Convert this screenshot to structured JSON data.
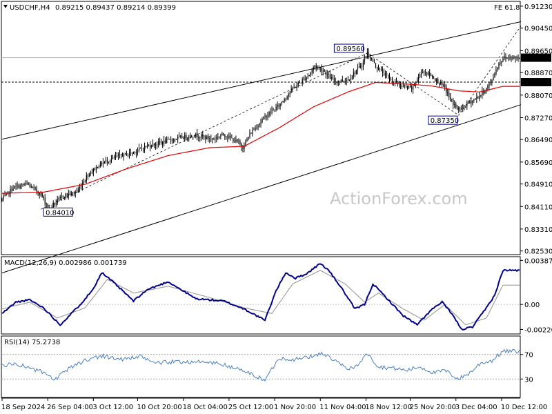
{
  "header": {
    "symbol_label": "USDCHF,H4",
    "ohlc_text": "0.89215 0.89437 0.89214 0.89399",
    "fe_label": "FE 61.8"
  },
  "watermark": "ActionForex.com",
  "colors": {
    "candle": "#000000",
    "ma": "#e00000",
    "macd_main": "#00008b",
    "macd_signal": "#909090",
    "channel": "#000000",
    "fib_dash": "#000000",
    "level_box": "#00008b",
    "price_tag_bg": "#000000",
    "price_tag_text": "#ffffff",
    "rsi_line": "#4a7fbf"
  },
  "chart_data": [
    {
      "type": "line",
      "panel": "price",
      "title": "USDCHF,H4",
      "ylim": [
        0.824,
        0.914
      ],
      "yticks": [
        "0.91230",
        "0.90450",
        "0.89650",
        "0.88870",
        "0.88070",
        "0.87270",
        "0.86490",
        "0.85690",
        "0.84910",
        "0.84110",
        "0.83310",
        "0.82530"
      ],
      "x_labels": [
        "18 Sep 2024",
        "26 Sep 04:00",
        "3 Oct 12:00",
        "10 Oct 20:00",
        "18 Oct 04:00",
        "25 Oct 12:00",
        "1 Nov 20:00",
        "11 Nov 04:00",
        "18 Nov 12:00",
        "25 Nov 20:00",
        "3 Dec 04:00",
        "10 Dec 12:00"
      ],
      "price_path": [
        [
          0,
          0.8436
        ],
        [
          8,
          0.8478
        ],
        [
          18,
          0.8491
        ],
        [
          28,
          0.8455
        ],
        [
          34,
          0.8402
        ],
        [
          44,
          0.8449
        ],
        [
          54,
          0.8462
        ],
        [
          62,
          0.8525
        ],
        [
          72,
          0.8565
        ],
        [
          84,
          0.859
        ],
        [
          94,
          0.8602
        ],
        [
          104,
          0.8625
        ],
        [
          116,
          0.864
        ],
        [
          128,
          0.8655
        ],
        [
          140,
          0.8665
        ],
        [
          152,
          0.865
        ],
        [
          160,
          0.8668
        ],
        [
          170,
          0.864
        ],
        [
          174,
          0.8622
        ],
        [
          180,
          0.8675
        ],
        [
          190,
          0.873
        ],
        [
          200,
          0.877
        ],
        [
          210,
          0.883
        ],
        [
          222,
          0.888
        ],
        [
          226,
          0.8912
        ],
        [
          232,
          0.8895
        ],
        [
          240,
          0.8855
        ],
        [
          250,
          0.8862
        ],
        [
          260,
          0.8915
        ],
        [
          264,
          0.8956
        ],
        [
          270,
          0.891
        ],
        [
          280,
          0.8865
        ],
        [
          288,
          0.884
        ],
        [
          296,
          0.883
        ],
        [
          304,
          0.8895
        ],
        [
          312,
          0.8868
        ],
        [
          320,
          0.8832
        ],
        [
          324,
          0.879
        ],
        [
          330,
          0.8753
        ],
        [
          336,
          0.8775
        ],
        [
          344,
          0.88
        ],
        [
          350,
          0.883
        ],
        [
          354,
          0.886
        ],
        [
          358,
          0.891
        ],
        [
          362,
          0.894
        ]
      ],
      "ma_path": [
        [
          0,
          0.8458
        ],
        [
          30,
          0.8462
        ],
        [
          60,
          0.849
        ],
        [
          90,
          0.8545
        ],
        [
          120,
          0.8592
        ],
        [
          150,
          0.862
        ],
        [
          175,
          0.8625
        ],
        [
          200,
          0.869
        ],
        [
          225,
          0.8765
        ],
        [
          250,
          0.8818
        ],
        [
          270,
          0.8852
        ],
        [
          290,
          0.8847
        ],
        [
          310,
          0.884
        ],
        [
          330,
          0.8822
        ],
        [
          345,
          0.8818
        ],
        [
          362,
          0.8838
        ]
      ],
      "channel_upper": [
        [
          0,
          0.865
        ],
        [
          375,
          0.9068
        ]
      ],
      "channel_lower": [
        [
          0,
          0.8175
        ],
        [
          375,
          0.8773
        ]
      ],
      "fib_path": [
        [
          28,
          0.8401
        ],
        [
          264,
          0.8956
        ],
        [
          330,
          0.8735
        ],
        [
          375,
          0.9053
        ]
      ],
      "hlines": [
        {
          "value": 0.89399,
          "style": "solid",
          "label": "0.89399"
        },
        {
          "value": 0.8853,
          "style": "dashed",
          "label": "0.88530"
        }
      ],
      "annotations": [
        {
          "label": "0.84010",
          "x": 28,
          "value": 0.8401
        },
        {
          "label": "0.89560",
          "x": 264,
          "value": 0.8956
        },
        {
          "label": "0.87350",
          "x": 330,
          "value": 0.8735
        }
      ]
    },
    {
      "type": "line",
      "panel": "macd",
      "title": "MACD(12,26,9) 0.002986 0.001739",
      "ylim": [
        -0.0026,
        0.0042
      ],
      "yticks": [
        "0.003873",
        "0.00",
        "-0.002201"
      ],
      "main": [
        [
          0,
          -0.0008
        ],
        [
          10,
          0.0002
        ],
        [
          20,
          0.0004
        ],
        [
          30,
          -0.0003
        ],
        [
          42,
          -0.0018
        ],
        [
          55,
          -0.0002
        ],
        [
          65,
          0.0012
        ],
        [
          72,
          0.0028
        ],
        [
          80,
          0.002
        ],
        [
          95,
          0.0003
        ],
        [
          105,
          0.0013
        ],
        [
          120,
          0.002
        ],
        [
          140,
          0.0005
        ],
        [
          160,
          0.0003
        ],
        [
          175,
          -0.0004
        ],
        [
          190,
          -0.0014
        ],
        [
          198,
          0.0012
        ],
        [
          205,
          0.0028
        ],
        [
          212,
          0.0023
        ],
        [
          220,
          0.0027
        ],
        [
          230,
          0.0036
        ],
        [
          236,
          0.003
        ],
        [
          245,
          0.0015
        ],
        [
          255,
          -0.0004
        ],
        [
          262,
          0.0
        ],
        [
          268,
          0.0018
        ],
        [
          276,
          0.0008
        ],
        [
          290,
          -0.001
        ],
        [
          300,
          -0.0018
        ],
        [
          310,
          -0.0005
        ],
        [
          318,
          0.0002
        ],
        [
          325,
          -0.0008
        ],
        [
          332,
          -0.0022
        ],
        [
          340,
          -0.002
        ],
        [
          350,
          -0.0003
        ],
        [
          356,
          0.0008
        ],
        [
          362,
          0.003
        ]
      ],
      "signal": [
        [
          0,
          -0.0004
        ],
        [
          20,
          0.0002
        ],
        [
          40,
          -0.0012
        ],
        [
          60,
          -0.0003
        ],
        [
          76,
          0.0022
        ],
        [
          95,
          0.001
        ],
        [
          120,
          0.0016
        ],
        [
          150,
          0.0006
        ],
        [
          175,
          -0.0003
        ],
        [
          195,
          -0.0008
        ],
        [
          210,
          0.0018
        ],
        [
          230,
          0.003
        ],
        [
          248,
          0.0018
        ],
        [
          262,
          0.0002
        ],
        [
          272,
          0.001
        ],
        [
          290,
          -0.0004
        ],
        [
          305,
          -0.0014
        ],
        [
          320,
          0.0
        ],
        [
          335,
          -0.0018
        ],
        [
          350,
          -0.0012
        ],
        [
          362,
          0.0017
        ]
      ]
    },
    {
      "type": "line",
      "panel": "rsi",
      "title": "RSI(14) 75.2738",
      "ylim": [
        0,
        100
      ],
      "yticks": [
        "70",
        "30"
      ],
      "levels": [
        70,
        30
      ],
      "rsi": [
        [
          0,
          52
        ],
        [
          10,
          55
        ],
        [
          20,
          48
        ],
        [
          30,
          40
        ],
        [
          38,
          28
        ],
        [
          50,
          50
        ],
        [
          62,
          62
        ],
        [
          72,
          68
        ],
        [
          85,
          62
        ],
        [
          100,
          66
        ],
        [
          112,
          56
        ],
        [
          125,
          58
        ],
        [
          140,
          58
        ],
        [
          155,
          56
        ],
        [
          168,
          48
        ],
        [
          178,
          40
        ],
        [
          190,
          28
        ],
        [
          200,
          64
        ],
        [
          212,
          62
        ],
        [
          222,
          66
        ],
        [
          232,
          72
        ],
        [
          240,
          60
        ],
        [
          250,
          46
        ],
        [
          258,
          54
        ],
        [
          264,
          72
        ],
        [
          272,
          50
        ],
        [
          282,
          48
        ],
        [
          292,
          44
        ],
        [
          302,
          50
        ],
        [
          312,
          40
        ],
        [
          320,
          44
        ],
        [
          330,
          30
        ],
        [
          338,
          40
        ],
        [
          346,
          56
        ],
        [
          354,
          60
        ],
        [
          362,
          75
        ]
      ]
    }
  ]
}
